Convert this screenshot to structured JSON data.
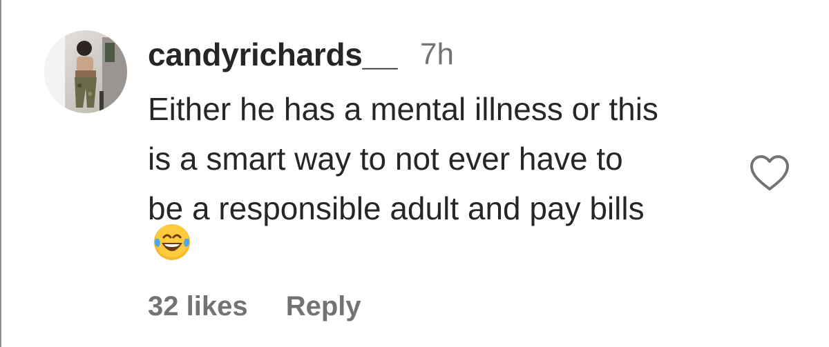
{
  "comment": {
    "avatar_icon": "user-avatar-photo",
    "username": "candyrichards__",
    "timestamp": "7h",
    "text_lines": [
      "Either he has a mental illness or this",
      "is a smart way to not ever have to",
      "be a responsible adult and pay bills"
    ],
    "emoji": "face-with-tears-of-joy",
    "likes_label": "32 likes",
    "reply_label": "Reply",
    "like_icon": "heart-outline-icon"
  },
  "colors": {
    "primary_text": "#262626",
    "secondary_text": "#737373",
    "background": "#ffffff"
  }
}
